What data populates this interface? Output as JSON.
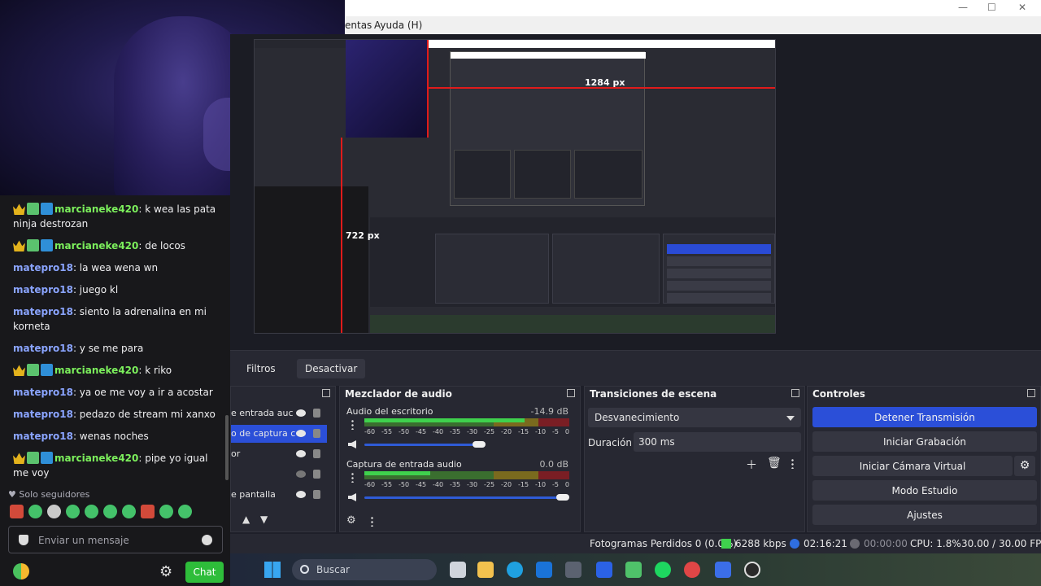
{
  "window": {
    "menu_partial": "entas",
    "menu_help": "Ayuda (H)",
    "win_minimize": "—",
    "win_maximize": "☐",
    "win_close": "✕"
  },
  "preview": {
    "width_label": "1284 px",
    "height_label": "722 px"
  },
  "chat": {
    "messages": [
      {
        "user": "marcianeke420",
        "badges": true,
        "text": "k wea las pata ninja destrozan"
      },
      {
        "user": "marcianeke420",
        "badges": true,
        "text": "de locos"
      },
      {
        "user": "matepro18",
        "badges": false,
        "text": "la wea wena wn"
      },
      {
        "user": "matepro18",
        "badges": false,
        "text": "juego kl"
      },
      {
        "user": "matepro18",
        "badges": false,
        "text": "siento la adrenalina en mi korneta"
      },
      {
        "user": "matepro18",
        "badges": false,
        "text": "y se me para"
      },
      {
        "user": "marcianeke420",
        "badges": true,
        "text": "k riko"
      },
      {
        "user": "matepro18",
        "badges": false,
        "text": "ya oe me voy a ir a acostar"
      },
      {
        "user": "matepro18",
        "badges": false,
        "text": "pedazo de stream mi xanxo"
      },
      {
        "user": "matepro18",
        "badges": false,
        "text": "wenas noches"
      },
      {
        "user": "marcianeke420",
        "badges": true,
        "text": "pipe yo igual me voy"
      }
    ],
    "followers_only": "Solo seguidores",
    "input_placeholder": "Enviar un mensaje",
    "chat_button": "Chat"
  },
  "obs": {
    "toolbar": {
      "filters": "Filtros",
      "disable": "Desactivar"
    },
    "sources": {
      "items": [
        {
          "label": "e entrada auc",
          "selected": false,
          "visible": true
        },
        {
          "label": "o de captura c",
          "selected": true,
          "visible": true
        },
        {
          "label": "or",
          "selected": false,
          "visible": true
        },
        {
          "label": "",
          "selected": false,
          "visible": false
        },
        {
          "label": "e pantalla",
          "selected": false,
          "visible": true
        }
      ]
    },
    "mixer": {
      "title": "Mezclador de audio",
      "ticks": [
        "-60",
        "-55",
        "-50",
        "-45",
        "-40",
        "-35",
        "-30",
        "-25",
        "-20",
        "-15",
        "-10",
        "-5",
        "0"
      ],
      "channels": [
        {
          "name": "Audio del escritorio",
          "db": "-14.9 dB",
          "level": 0.78,
          "volume": 0.56
        },
        {
          "name": "Captura de entrada audio",
          "db": "0.0 dB",
          "level": 0.32,
          "volume": 0.97
        }
      ]
    },
    "transitions": {
      "title": "Transiciones de escena",
      "selected": "Desvanecimiento",
      "duration_label": "Duración",
      "duration_value": "300 ms"
    },
    "controls": {
      "title": "Controles",
      "stop_stream": "Detener Transmisión",
      "start_recording": "Iniciar Grabación",
      "start_virtual_cam": "Iniciar Cámara Virtual",
      "studio_mode": "Modo Estudio",
      "settings": "Ajustes"
    },
    "status": {
      "dropped_frames": "Fotogramas Perdidos 0 (0.0%)",
      "bitrate": "6288 kbps",
      "stream_time": "02:16:21",
      "rec_time": "00:00:00",
      "cpu": "CPU: 1.8%",
      "fps": "30.00 / 30.00 FPS"
    }
  },
  "taskbar": {
    "search_label": "Buscar"
  },
  "colors": {
    "accent_blue": "#2b4fd8",
    "chat_green_user": "#7cf05c",
    "chat_blue_user": "#8aa4ff",
    "chat_button": "#2ebd3a"
  }
}
